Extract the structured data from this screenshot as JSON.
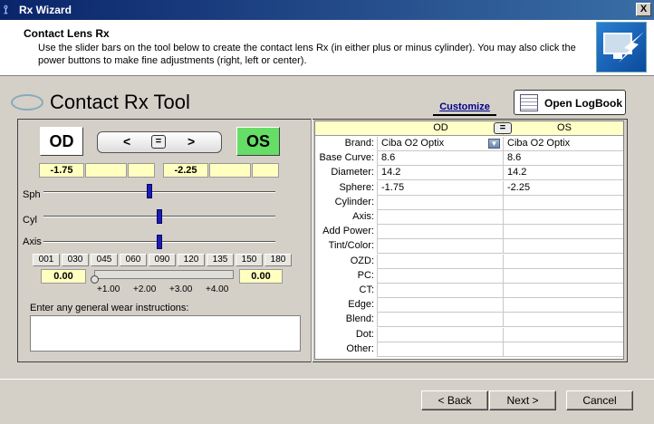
{
  "window": {
    "title": "Rx Wizard",
    "close_glyph": "X"
  },
  "header": {
    "title": "Contact Lens Rx",
    "description": "Use the slider bars on the tool below to create the contact lens Rx (in either plus or minus cylinder).  You may also click the power buttons to make fine adjustments (right, left or center)."
  },
  "tool": {
    "title": "Contact Rx Tool",
    "customize_label": "Customize",
    "logbook_label": "Open LogBook",
    "od_label": "OD",
    "os_label": "OS",
    "nav_left": "<",
    "nav_center": "=",
    "nav_right": ">",
    "od_values": {
      "sph": "-1.75",
      "cyl": "",
      "axis": ""
    },
    "os_values": {
      "sph": "-2.25",
      "cyl": "",
      "axis": ""
    },
    "slider_labels": {
      "sph": "Sph",
      "cyl": "Cyl",
      "axis": "Axis"
    },
    "axis_buttons": [
      "001",
      "030",
      "045",
      "060",
      "090",
      "120",
      "135",
      "150",
      "180"
    ],
    "add": {
      "od_value": "0.00",
      "os_value": "0.00",
      "ticks": [
        "+1.00",
        "+2.00",
        "+3.00",
        "+4.00"
      ]
    },
    "wear_label": "Enter any general wear instructions:",
    "wear_value": ""
  },
  "grid": {
    "col_od": "OD",
    "col_os": "OS",
    "eq_glyph": "=",
    "rows": [
      {
        "label": "Brand:",
        "od": "Ciba O2 Optix",
        "os": "Ciba O2 Optix"
      },
      {
        "label": "Base Curve:",
        "od": "8.6",
        "os": "8.6"
      },
      {
        "label": "Diameter:",
        "od": "14.2",
        "os": "14.2"
      },
      {
        "label": "Sphere:",
        "od": "-1.75",
        "os": "-2.25"
      },
      {
        "label": "Cylinder:",
        "od": "",
        "os": ""
      },
      {
        "label": "Axis:",
        "od": "",
        "os": ""
      },
      {
        "label": "Add Power:",
        "od": "",
        "os": ""
      },
      {
        "label": "Tint/Color:",
        "od": "",
        "os": ""
      },
      {
        "label": "OZD:",
        "od": "",
        "os": ""
      },
      {
        "label": "PC:",
        "od": "",
        "os": ""
      },
      {
        "label": "CT:",
        "od": "",
        "os": ""
      },
      {
        "label": "Edge:",
        "od": "",
        "os": ""
      },
      {
        "label": "Blend:",
        "od": "",
        "os": ""
      },
      {
        "label": "Dot:",
        "od": "",
        "os": ""
      },
      {
        "label": "Other:",
        "od": "",
        "os": ""
      }
    ]
  },
  "buttons": {
    "back": "< Back",
    "next": "Next >",
    "cancel": "Cancel"
  },
  "icons": {
    "title_icon": "app-icon",
    "wizard_icon": "monitor-arrow-icon",
    "logbook_icon": "logbook-icon",
    "dropdown_icon": "chevron-down-icon"
  }
}
